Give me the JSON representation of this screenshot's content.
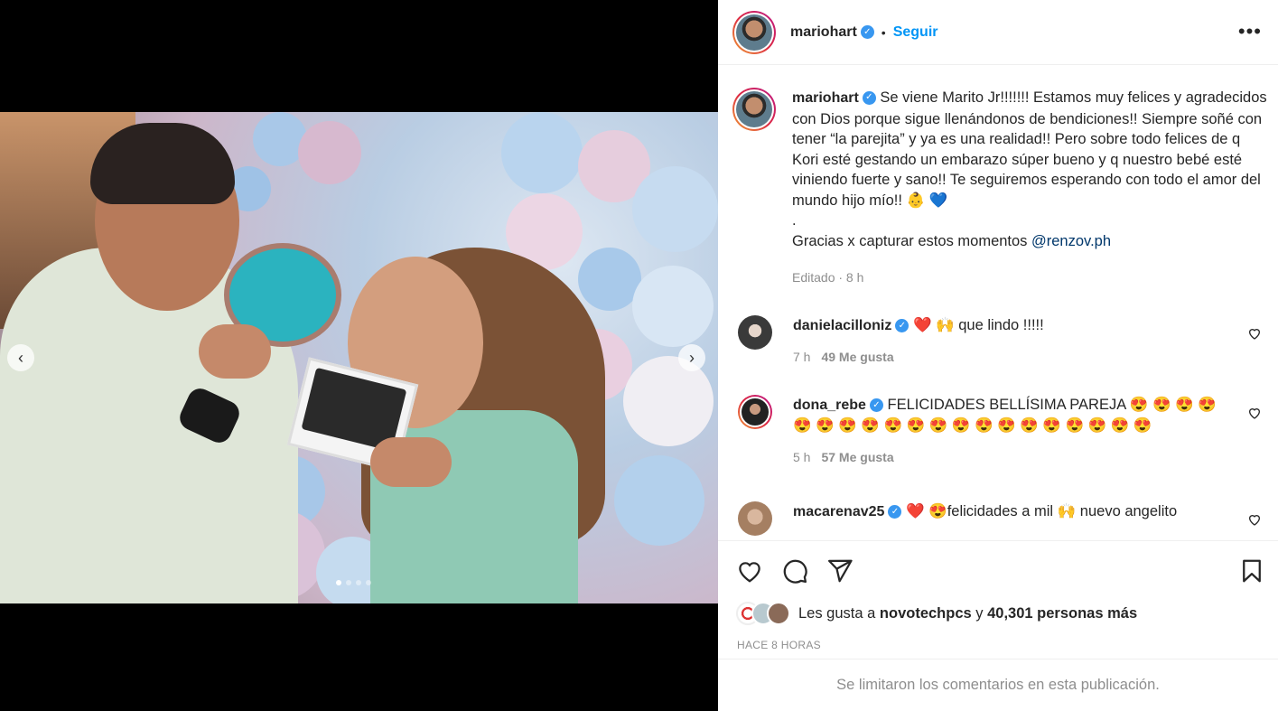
{
  "header": {
    "username": "mariohart",
    "bullet": "•",
    "follow_label": "Seguir",
    "more_label": "•••"
  },
  "caption": {
    "username": "mariohart",
    "text": "Se viene Marito Jr!!!!!!! Estamos muy felices y agradecidos con Dios porque sigue llenándonos de bendiciones!! Siempre soñé con tener “la parejita” y ya es una realidad!! Pero sobre todo felices de q Kori esté gestando un embarazo súper bueno y q nuestro bebé esté viniendo fuerte y sano!! Te seguiremos esperando con todo el amor del mundo hijo mío!! 👶 💙",
    "dot": ".",
    "thanks_text": "Gracias x capturar estos momentos ",
    "mention": "@renzov.ph",
    "meta": "Editado · 8 h"
  },
  "comments": [
    {
      "username": "danielacilloniz",
      "text": "❤️ 🙌 que lindo !!!!!",
      "time": "7 h",
      "likes": "49 Me gusta"
    },
    {
      "username": "dona_rebe",
      "text": "FELICIDADES BELLÍSIMA PAREJA 😍 😍 😍 😍 😍 😍 😍 😍 😍 😍 😍 😍 😍 😍 😍 😍 😍 😍 😍 😍",
      "time": "5 h",
      "likes": "57 Me gusta"
    },
    {
      "username": "macarenav25",
      "text": "❤️ 😍felicidades a mil 🙌 nuevo angelito",
      "time": "",
      "likes": ""
    }
  ],
  "likes": {
    "prefix": "Les gusta a ",
    "user": "novotechpcs",
    "middle": " y ",
    "count": "40,301 personas más"
  },
  "time_label": "HACE 8 HORAS",
  "limited_text": "Se limitaron los comentarios en esta publicación.",
  "carousel": {
    "prev": "‹",
    "next": "›",
    "total_slides": 4,
    "active_slide": 1
  },
  "colors": {
    "accent": "#0095f6",
    "verified": "#3897f0",
    "text": "#262626",
    "muted": "#8e8e8e"
  }
}
